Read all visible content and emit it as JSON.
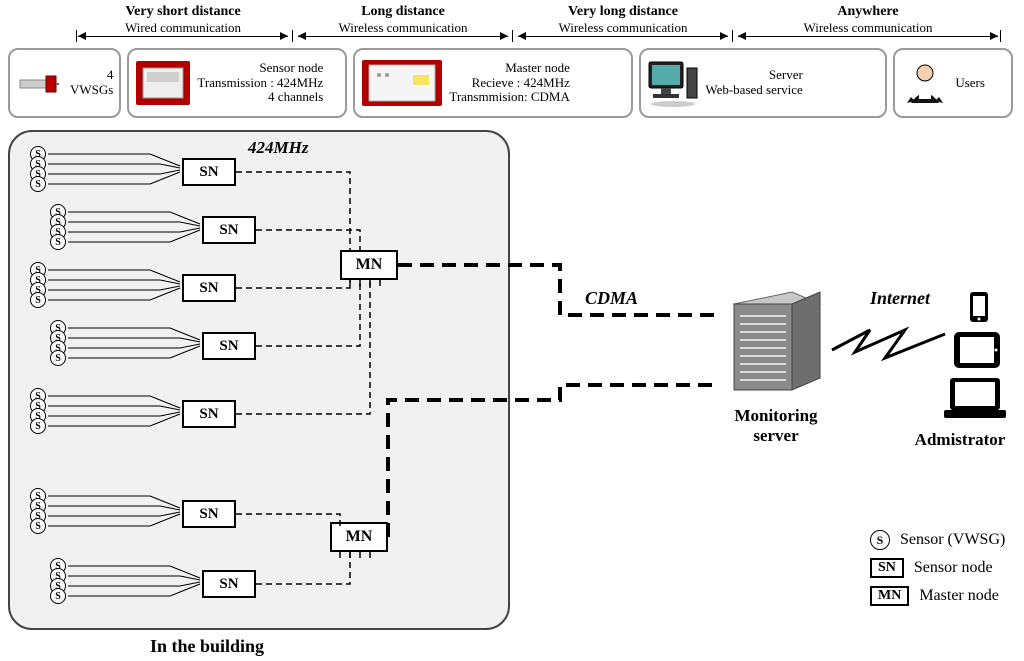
{
  "top_categories": [
    {
      "title": "Very short distance",
      "sub": "Wired communication"
    },
    {
      "title": "Long distance",
      "sub": "Wireless communication"
    },
    {
      "title": "Very long distance",
      "sub": "Wireless communication"
    },
    {
      "title": "Anywhere",
      "sub": "Wireless communication"
    }
  ],
  "legend_row": {
    "box1": {
      "title": "4 VWSGs"
    },
    "box2": {
      "title": "Sensor node",
      "line2": "Transmission : 424MHz",
      "line3": "4 channels"
    },
    "box3": {
      "title": "Master node",
      "line2": "Recieve : 424MHz",
      "line3": "Transmmision: CDMA"
    },
    "box4": {
      "title": "Server",
      "line2": "Web-based service"
    },
    "box5": {
      "title": "Users"
    }
  },
  "diagram": {
    "freq_label": "424MHz",
    "building_label": "In the building",
    "sn_label": "SN",
    "mn_label": "MN",
    "sensor_letter": "S",
    "sn_count": 7,
    "mn_count": 2,
    "sensors_per_sn": 4
  },
  "labels": {
    "cdma": "CDMA",
    "internet": "Internet",
    "server": "Monitoring server",
    "admin": "Admistrator"
  },
  "legend2": {
    "sensor": "Sensor (VWSG)",
    "sn": "Sensor node",
    "mn": "Master node",
    "s_letter": "S",
    "sn_label": "SN",
    "mn_label": "MN"
  }
}
